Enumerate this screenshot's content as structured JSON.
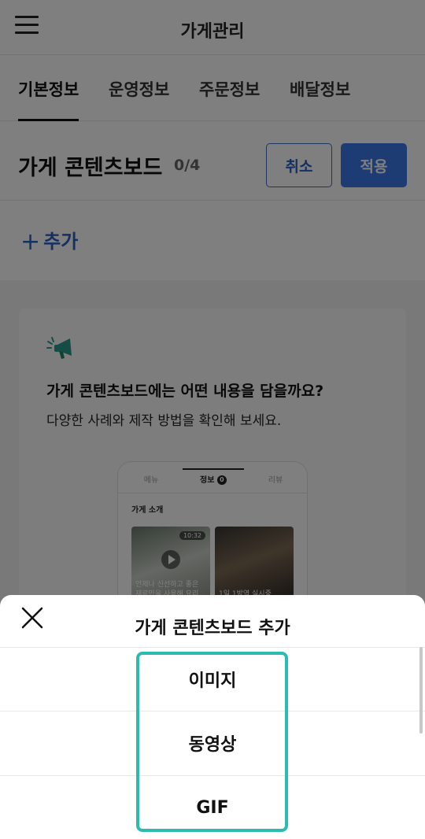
{
  "header": {
    "title": "가게관리",
    "menu_icon": "hamburger-menu-icon"
  },
  "tabs": [
    {
      "label": "기본정보",
      "active": true
    },
    {
      "label": "운영정보",
      "active": false
    },
    {
      "label": "주문정보",
      "active": false
    },
    {
      "label": "배달정보",
      "active": false
    }
  ],
  "content_board": {
    "title": "가게 콘텐츠보드",
    "count": "0/4",
    "cancel_label": "취소",
    "apply_label": "적용",
    "add_label": "추가"
  },
  "info_card": {
    "icon": "megaphone-icon",
    "title": "가게 콘텐츠보드에는 어떤 내용을 담을까요?",
    "subtitle": "다양한 사례와 제작 방법을 확인해 보세요.",
    "preview": {
      "tabs": [
        "메뉴",
        "정보",
        "리뷰"
      ],
      "active_tab_badge": "0",
      "section_title": "가게 소개",
      "video_duration": "10:32",
      "card1_caption": "언제나 신선하고 좋은 재료만을 사용해 요리…",
      "card2_caption": "1일 1방역 실시중"
    }
  },
  "sheet": {
    "title": "가게 콘텐츠보드 추가",
    "close_icon": "close-icon",
    "options": [
      "이미지",
      "동영상",
      "GIF"
    ]
  },
  "colors": {
    "accent_blue": "#3a78e6",
    "link_blue": "#2b60c4",
    "highlight_teal": "#2bbbb0"
  }
}
